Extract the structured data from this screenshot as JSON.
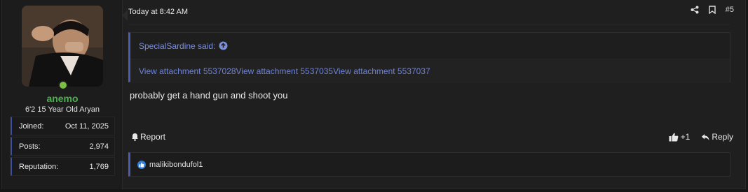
{
  "user": {
    "name": "anemo",
    "title": "6'2 15 Year Old Aryan",
    "stats": [
      {
        "label": "Joined:",
        "value": "Oct 11, 2025"
      },
      {
        "label": "Posts:",
        "value": "2,974"
      },
      {
        "label": "Reputation:",
        "value": "1,769"
      }
    ],
    "avatar_icon": "avatar-photo",
    "online_color": "#7bc043"
  },
  "post": {
    "date": "Today at 8:42 AM",
    "number": "#5",
    "quote": {
      "author_line": "SpecialSardine said:",
      "attachments": [
        "View attachment 5537028",
        "View attachment 5537035",
        "View attachment 5537037"
      ]
    },
    "body": "probably get a hand gun and shoot you",
    "report_label": "Report",
    "like_count": "+1",
    "reply_label": "Reply",
    "reactions_user": "malikibondufol1"
  },
  "colors": {
    "accent": "#4a5bb0",
    "link": "#7b8ede",
    "username": "#4caf50",
    "like": "#2f7fd8"
  }
}
